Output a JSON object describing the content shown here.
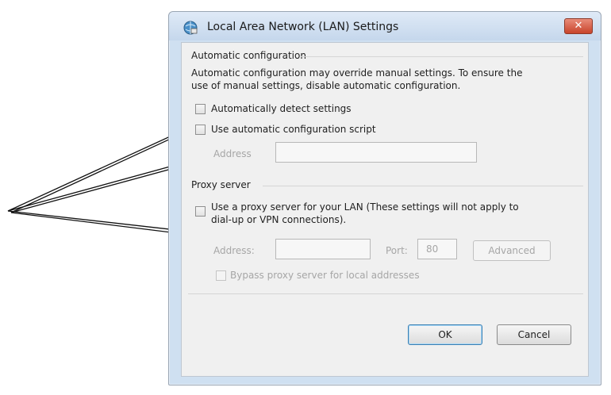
{
  "dialog": {
    "title": "Local Area Network (LAN) Settings",
    "close_label": "✕"
  },
  "automatic_configuration": {
    "heading": "Automatic configuration",
    "description_line1": "Automatic configuration may override manual settings.  To ensure the",
    "description_line2": "use of manual settings, disable automatic configuration.",
    "auto_detect_label": "Automatically detect settings",
    "auto_detect_checked": false,
    "use_script_label": "Use automatic configuration script",
    "use_script_checked": false,
    "address_label": "Address",
    "address_value": ""
  },
  "proxy_server": {
    "heading": "Proxy server",
    "use_proxy_label_line1": "Use a proxy server for your LAN (These settings will not apply to",
    "use_proxy_label_line2": "dial-up or VPN connections).",
    "use_proxy_checked": false,
    "address_label": "Address:",
    "address_value": "",
    "port_label": "Port:",
    "port_value": "80",
    "advanced_label": "Advanced",
    "bypass_label": "Bypass proxy server for local addresses",
    "bypass_checked": false
  },
  "buttons": {
    "ok": "OK",
    "cancel": "Cancel"
  },
  "colors": {
    "accent": "#3c7fb1",
    "disabled_text": "#a6a6a6",
    "close_button": "#c8442b"
  }
}
